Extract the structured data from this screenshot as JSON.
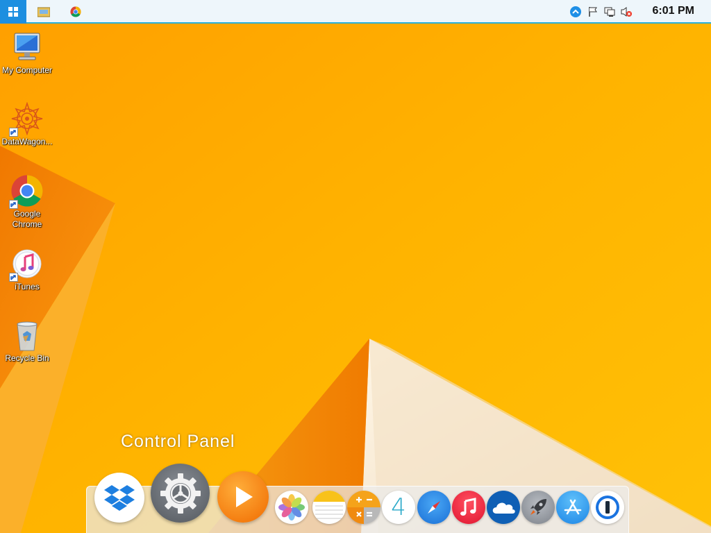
{
  "taskbar": {
    "start_icon": "windows-logo-icon",
    "pinned": [
      {
        "name": "file-explorer",
        "icon": "folder-icon"
      },
      {
        "name": "chrome",
        "icon": "chrome-icon"
      }
    ],
    "tray": [
      {
        "name": "show-hidden",
        "icon": "chevron-up-icon"
      },
      {
        "name": "action-center",
        "icon": "flag-icon"
      },
      {
        "name": "network",
        "icon": "network-icon"
      },
      {
        "name": "volume-muted",
        "icon": "speaker-muted-icon"
      }
    ],
    "clock": "6:01 PM",
    "accent_color": "#1d8fe0"
  },
  "desktop": {
    "icons": [
      {
        "label": "My Computer",
        "icon": "computer-icon"
      },
      {
        "label": "DataWagon...",
        "icon": "datawagon-icon"
      },
      {
        "label": "Google Chrome",
        "icon": "chrome-icon"
      },
      {
        "label": "iTunes",
        "icon": "itunes-icon"
      },
      {
        "label": "Recycle Bin",
        "icon": "recycle-bin-icon"
      }
    ]
  },
  "dock": {
    "hover_label": "Control Panel",
    "items": [
      {
        "name": "dropbox",
        "icon": "dropbox-icon"
      },
      {
        "name": "control-panel",
        "icon": "gear-icon"
      },
      {
        "name": "media-player",
        "icon": "play-icon"
      },
      {
        "name": "photos",
        "icon": "photos-icon"
      },
      {
        "name": "notes",
        "icon": "notes-icon"
      },
      {
        "name": "calculator",
        "icon": "calculator-icon"
      },
      {
        "name": "calendar",
        "icon": "calendar-icon",
        "text": "4"
      },
      {
        "name": "safari",
        "icon": "compass-icon"
      },
      {
        "name": "music",
        "icon": "music-icon"
      },
      {
        "name": "onedrive",
        "icon": "cloud-icon"
      },
      {
        "name": "launchpad",
        "icon": "rocket-icon"
      },
      {
        "name": "app-store",
        "icon": "app-store-icon"
      },
      {
        "name": "1password",
        "icon": "1password-icon"
      }
    ]
  }
}
